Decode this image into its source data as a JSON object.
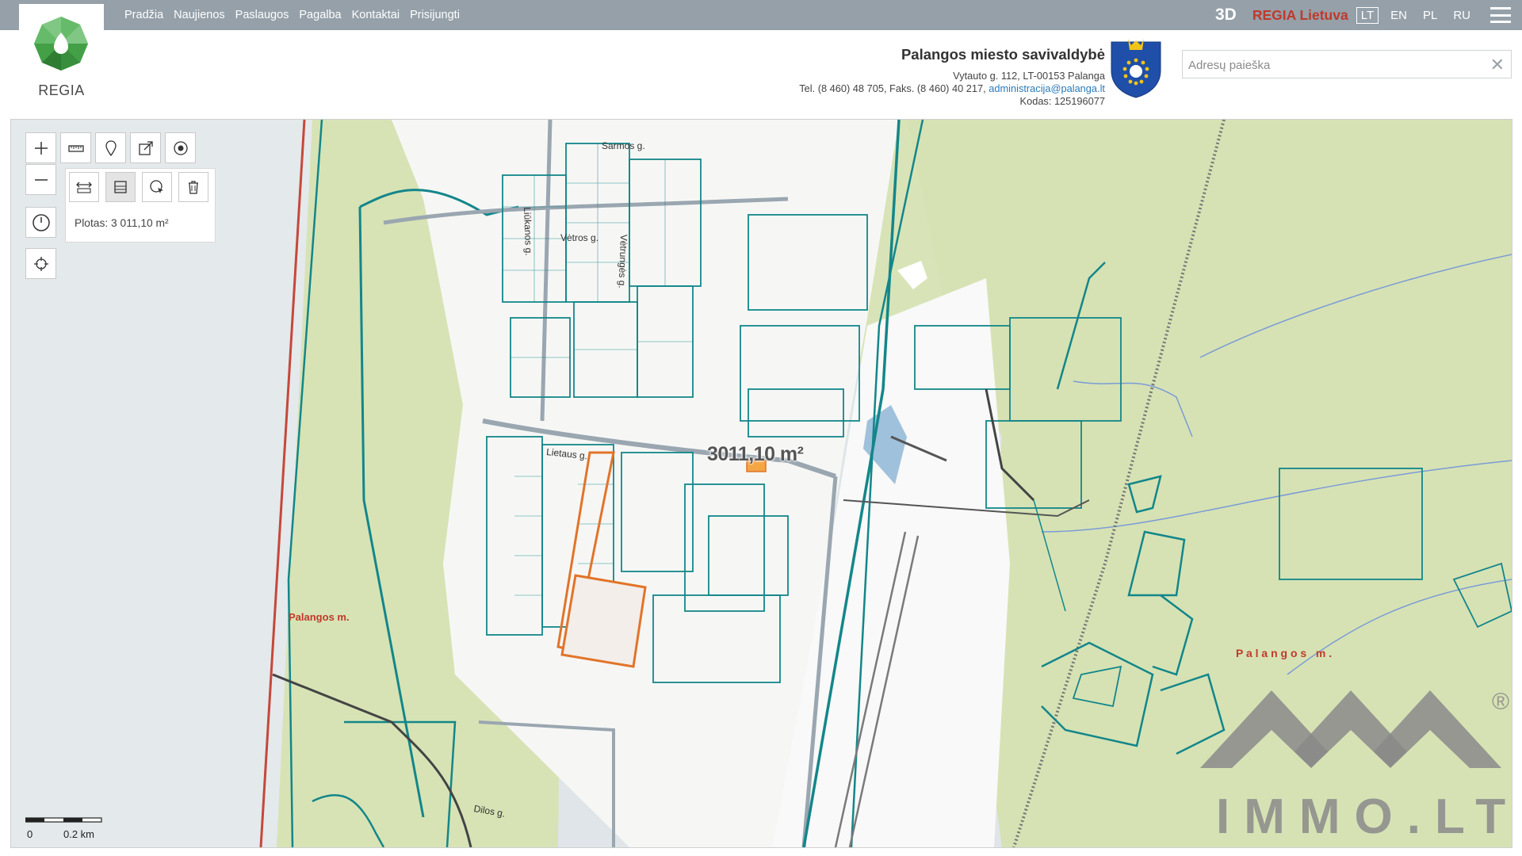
{
  "nav": [
    "Pradžia",
    "Naujienos",
    "Paslaugos",
    "Pagalba",
    "Kontaktai",
    "Prisijungti"
  ],
  "top_right": {
    "btn_3d": "3D",
    "regia_lietuva": "REGIA Lietuva",
    "languages": [
      "LT",
      "EN",
      "PL",
      "RU"
    ],
    "active_language": "LT"
  },
  "logo": {
    "text": "REGIA"
  },
  "municipality": {
    "name": "Palangos miesto savivaldybė",
    "address": "Vytauto g. 112, LT-00153 Palanga",
    "phone": "Tel. (8 460) 48 705, Faks. (8 460) 40 217, ",
    "email": "administracija@palanga.lt",
    "code": "Kodas: 125196077"
  },
  "search": {
    "placeholder": "Adresų paieška",
    "value": ""
  },
  "map": {
    "area_label": "3011,10 m²",
    "plotas": "Plotas: 3 011,10 m²",
    "scale": {
      "zero": "0",
      "distance": "0.2 km"
    },
    "place_label_left": "Palangos m.",
    "place_label_right": "P a l a n g o s   m .",
    "streets": [
      "Sarmos g.",
      "Vėtros g.",
      "Liūkanos g.",
      "Vėtrungės g.",
      "Lietaus g.",
      "Dilos g."
    ],
    "watermark": "IMMO.LT",
    "watermark_mark": "®"
  },
  "colors": {
    "topbar": "#95a0a9",
    "parcel_line": "#13868a",
    "selected_parcel": "#e2742a",
    "greenland": "#d6e2b4",
    "sea": "#dfe5e8",
    "brand_red": "#c0392b"
  },
  "icons": {
    "zoom_in": "plus-icon",
    "zoom_out": "minus-icon",
    "measure": "ruler-icon",
    "marker": "map-pin-icon",
    "share": "share-icon",
    "location": "target-icon",
    "measure_distance": "measure-distance-icon",
    "measure_area": "measure-area-icon",
    "select_area": "select-area-icon",
    "delete": "trash-icon",
    "history": "clock-icon",
    "crosshair": "crosshair-icon"
  }
}
